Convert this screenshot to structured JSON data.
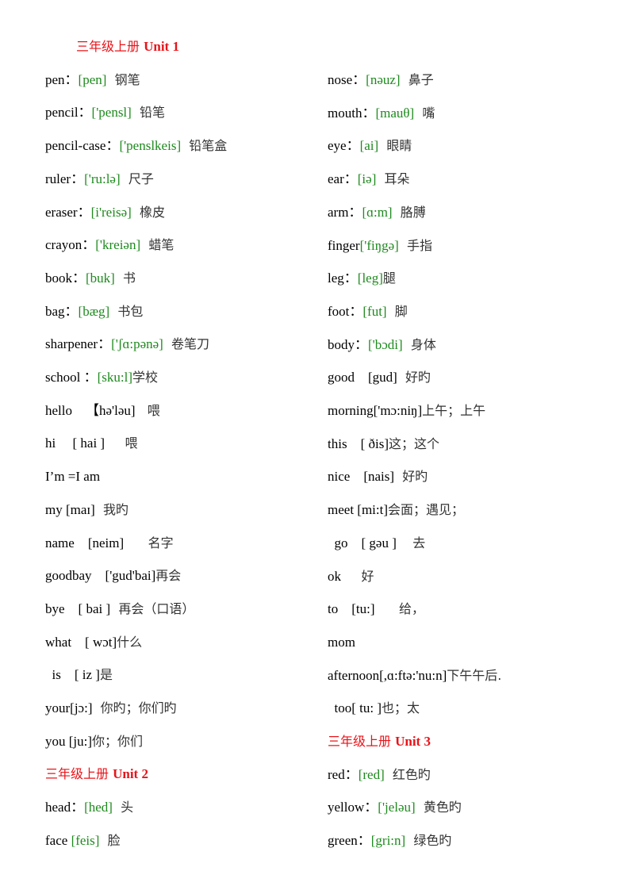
{
  "colors": {
    "heading": "#e8141a",
    "phonetic": "#1e8a1e",
    "text": "#000000"
  },
  "left": [
    {
      "type": "heading",
      "cn": "三年级上册 ",
      "unit": "Unit 1",
      "indent": true
    },
    {
      "type": "entry",
      "word": "pen：",
      "ipa": "[pen]",
      "cn": "  钢笔",
      "green": true
    },
    {
      "type": "entry",
      "word": "pencil：",
      "ipa": "['pensl]",
      "cn": "  铅笔",
      "green": true
    },
    {
      "type": "entry",
      "word": "pencil-case：",
      "ipa": "['penslkeis]",
      "cn": "  铅笔盒",
      "green": true
    },
    {
      "type": "entry",
      "word": "ruler：",
      "ipa": "['ru:lə]",
      "cn": "  尺子",
      "green": true
    },
    {
      "type": "entry",
      "word": "eraser：",
      "ipa": "[i'reisə]",
      "cn": "  橡皮",
      "green": true
    },
    {
      "type": "entry",
      "word": "crayon：",
      "ipa": "['kreiən]",
      "cn": "  蜡笔",
      "green": true
    },
    {
      "type": "entry",
      "word": "book：",
      "ipa": "[buk]",
      "cn": "  书",
      "green": true
    },
    {
      "type": "entry",
      "word": "bag：",
      "ipa": "[bæg]",
      "cn": "  书包",
      "green": true
    },
    {
      "type": "entry",
      "word": "sharpener：",
      "ipa": "['ʃɑ:pənə]",
      "cn": "  卷笔刀",
      "green": true
    },
    {
      "type": "entry",
      "word": "school ：",
      "ipa": "[sku:l]",
      "cn": "学校",
      "green": true
    },
    {
      "type": "entry",
      "word": "hello    ",
      "ipa": "【hə'ləu]",
      "cn": "   喂",
      "green": false
    },
    {
      "type": "entry",
      "word": "hi     ",
      "ipa": "[ hai ]",
      "cn": "     喂",
      "green": false
    },
    {
      "type": "entry",
      "word": "I’m =I am",
      "ipa": "",
      "cn": "",
      "green": false
    },
    {
      "type": "entry",
      "word": "my ",
      "ipa": "[maɪ]",
      "cn": "  我旳",
      "green": false
    },
    {
      "type": "entry",
      "word": "name    ",
      "ipa": "[neim]",
      "cn": "      名字",
      "green": false
    },
    {
      "type": "entry",
      "word": "goodbay    ",
      "ipa": "['gud'bai]",
      "cn": "再会",
      "green": false
    },
    {
      "type": "entry",
      "word": "bye    ",
      "ipa": "[ bai ]",
      "cn": "  再会（口语）",
      "green": false
    },
    {
      "type": "entry",
      "word": "what    ",
      "ipa": "[ wɔt]",
      "cn": "什么",
      "green": false
    },
    {
      "type": "entry",
      "word": "  is    ",
      "ipa": "[ iz ]",
      "cn": "是",
      "green": false
    },
    {
      "type": "entry",
      "word": "your",
      "ipa": "[jɔ:]",
      "cn": "  你旳；你们旳",
      "green": false
    },
    {
      "type": "entry",
      "word": "you ",
      "ipa": "[ju:]",
      "cn": "你；你们",
      "green": false
    },
    {
      "type": "heading",
      "cn": "三年级上册 ",
      "unit": "Unit 2",
      "indent": false
    },
    {
      "type": "entry",
      "word": "head：",
      "ipa": "[hed]",
      "cn": "  头",
      "green": true
    },
    {
      "type": "entry",
      "word": "face ",
      "ipa": "[feis]",
      "cn": "  脸",
      "green": true
    }
  ],
  "right": [
    {
      "type": "entry",
      "word": "nose：",
      "ipa": "[nəuz]",
      "cn": "  鼻子",
      "green": true
    },
    {
      "type": "entry",
      "word": "mouth：",
      "ipa": "[mauθ]",
      "cn": "  嘴",
      "green": true
    },
    {
      "type": "entry",
      "word": "eye：",
      "ipa": "[ai]",
      "cn": "  眼睛",
      "green": true
    },
    {
      "type": "entry",
      "word": "ear：",
      "ipa": "[iə]",
      "cn": "  耳朵",
      "green": true
    },
    {
      "type": "entry",
      "word": "arm：",
      "ipa": "[ɑ:m]",
      "cn": "  胳膊",
      "green": true
    },
    {
      "type": "entry",
      "word": "finger",
      "ipa": "['fiŋgə]",
      "cn": "  手指",
      "green": true
    },
    {
      "type": "entry",
      "word": "leg：",
      "ipa": "[leg]",
      "cn": "腿",
      "green": true
    },
    {
      "type": "entry",
      "word": "foot：",
      "ipa": "[fut]",
      "cn": "  脚",
      "green": true
    },
    {
      "type": "entry",
      "word": "body：",
      "ipa": "['bɔdi]",
      "cn": "  身体",
      "green": true
    },
    {
      "type": "entry",
      "word": "good    ",
      "ipa": "[gud]",
      "cn": "  好旳",
      "green": false
    },
    {
      "type": "entry",
      "word": "morning",
      "ipa": "['mɔ:niŋ]",
      "cn": "上午；上午",
      "green": false
    },
    {
      "type": "entry",
      "word": "this    ",
      "ipa": "[ ðis]",
      "cn": "这；这个",
      "green": false
    },
    {
      "type": "entry",
      "word": "nice    ",
      "ipa": "[nais]",
      "cn": "  好旳",
      "green": false
    },
    {
      "type": "entry",
      "word": "meet ",
      "ipa": "[mi:t]",
      "cn": "会面；遇见；",
      "green": false
    },
    {
      "type": "entry",
      "word": "  go    ",
      "ipa": "[ gəu ]",
      "cn": "    去",
      "green": false
    },
    {
      "type": "entry",
      "word": "ok      ",
      "ipa": "",
      "cn": "好",
      "green": false
    },
    {
      "type": "entry",
      "word": "to    ",
      "ipa": "[tu:]",
      "cn": "      给，",
      "green": false
    },
    {
      "type": "entry",
      "word": "mom",
      "ipa": "",
      "cn": "",
      "green": false
    },
    {
      "type": "entry",
      "word": "afternoon",
      "ipa": "[,ɑ:ftə:'nu:n]",
      "cn": "下午午后.",
      "green": false
    },
    {
      "type": "entry",
      "word": "  too",
      "ipa": "[ tu: ]",
      "cn": "也；太",
      "green": false
    },
    {
      "type": "heading",
      "cn": "三年级上册 ",
      "unit": "Unit 3",
      "indent": false
    },
    {
      "type": "entry",
      "word": "red：",
      "ipa": "[red]",
      "cn": "  红色旳",
      "green": true
    },
    {
      "type": "entry",
      "word": "yellow：",
      "ipa": "['jeləu]",
      "cn": "  黄色旳",
      "green": true
    },
    {
      "type": "entry",
      "word": "green：",
      "ipa": "[gri:n]",
      "cn": "  绿色旳",
      "green": true
    }
  ]
}
